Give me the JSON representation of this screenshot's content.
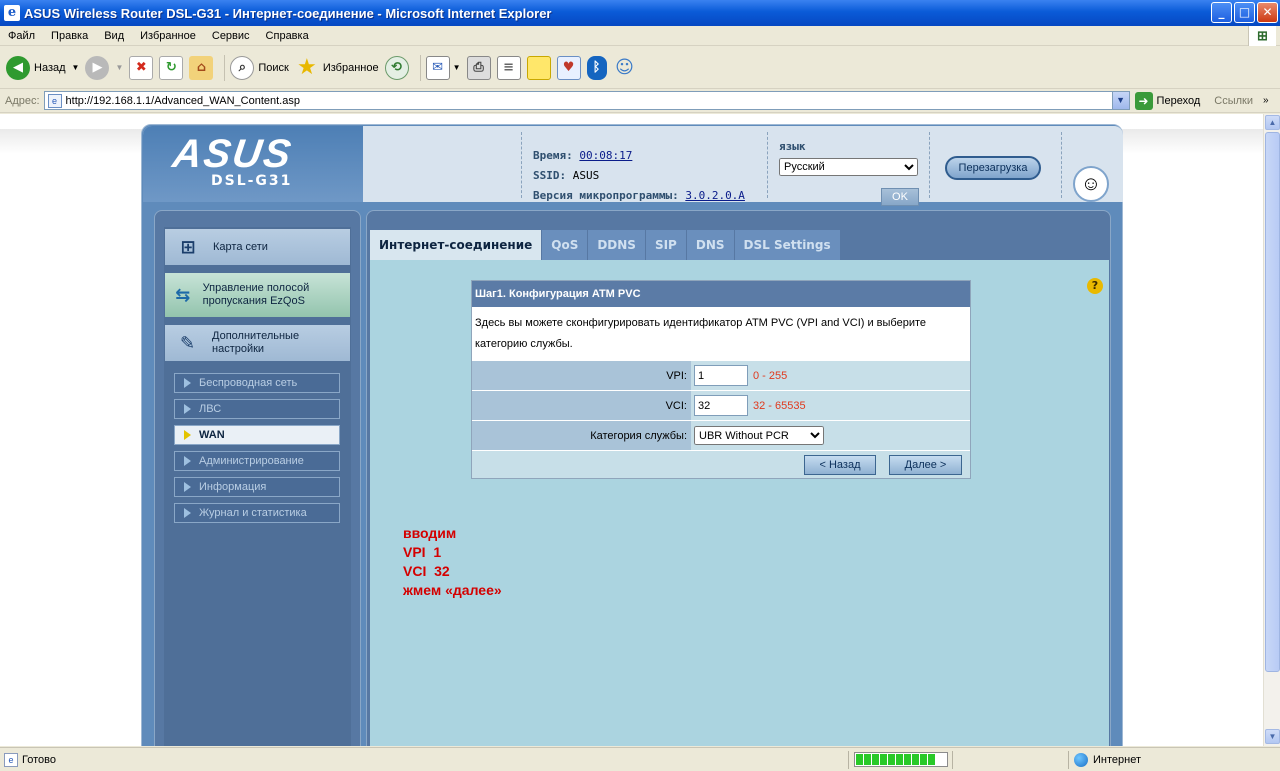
{
  "window": {
    "title": "ASUS Wireless Router DSL-G31 - Интернет-соединение - Microsoft Internet Explorer",
    "controls": {
      "minimize": "_",
      "maximize": "□",
      "close": "✕"
    }
  },
  "menu": [
    "Файл",
    "Правка",
    "Вид",
    "Избранное",
    "Сервис",
    "Справка"
  ],
  "toolbar": {
    "back_label": "Назад",
    "search_label": "Поиск",
    "favorites_label": "Избранное"
  },
  "address": {
    "label": "Адрес:",
    "url": "http://192.168.1.1/Advanced_WAN_Content.asp",
    "go_label": "Переход",
    "links_label": "Ссылки"
  },
  "router": {
    "logo": "ASUS",
    "model": "DSL-G31",
    "time_label": "Время:",
    "time_value": "00:08:17",
    "ssid_label": "SSID:",
    "ssid_value": "ASUS",
    "firmware_label": "Версия микропрограммы:",
    "firmware_value": "3.0.2.0.A",
    "language_label": "язык",
    "language_selected": "Русский",
    "ok_label": "OK",
    "reboot_label": "Перезагрузка"
  },
  "sidebar": {
    "main_items": [
      {
        "label": "Карта сети",
        "icon": "network-map-icon"
      },
      {
        "label": "Управление полосой пропускания EzQoS",
        "icon": "ezqos-icon"
      },
      {
        "label": "Дополнительные настройки",
        "icon": "tools-icon"
      }
    ],
    "sub_items": [
      {
        "label": "Беспроводная сеть"
      },
      {
        "label": "ЛВС"
      },
      {
        "label": "WAN"
      },
      {
        "label": "Администрирование"
      },
      {
        "label": "Информация"
      },
      {
        "label": "Журнал и статистика"
      }
    ]
  },
  "tabs": [
    "Интернет-соединение",
    "QoS",
    "DDNS",
    "SIP",
    "DNS",
    "DSL Settings"
  ],
  "form": {
    "title": "Шаг1. Конфигурация ATM PVC",
    "description": "Здесь вы можете сконфигурировать идентификатор ATM PVC (VPI and VCI) и выберите категорию службы.",
    "vpi_label": "VPI:",
    "vpi_value": "1",
    "vpi_range": "0 - 255",
    "vci_label": "VCI:",
    "vci_value": "32",
    "vci_range": "32 - 65535",
    "category_label": "Категория службы:",
    "category_value": "UBR Without PCR",
    "back_button": "< Назад",
    "next_button": "Далее >"
  },
  "annotation": [
    "вводим",
    "VPI  1",
    "VCI  32",
    "жмем «далее»"
  ],
  "status": {
    "text": "Готово",
    "zone": "Интернет",
    "progress": 1.0
  },
  "colors": {
    "title_bar": "#0A5BD8",
    "router_frame": "#5778a3",
    "content_bg": "#abd4e0",
    "annotation": "#d40000"
  }
}
